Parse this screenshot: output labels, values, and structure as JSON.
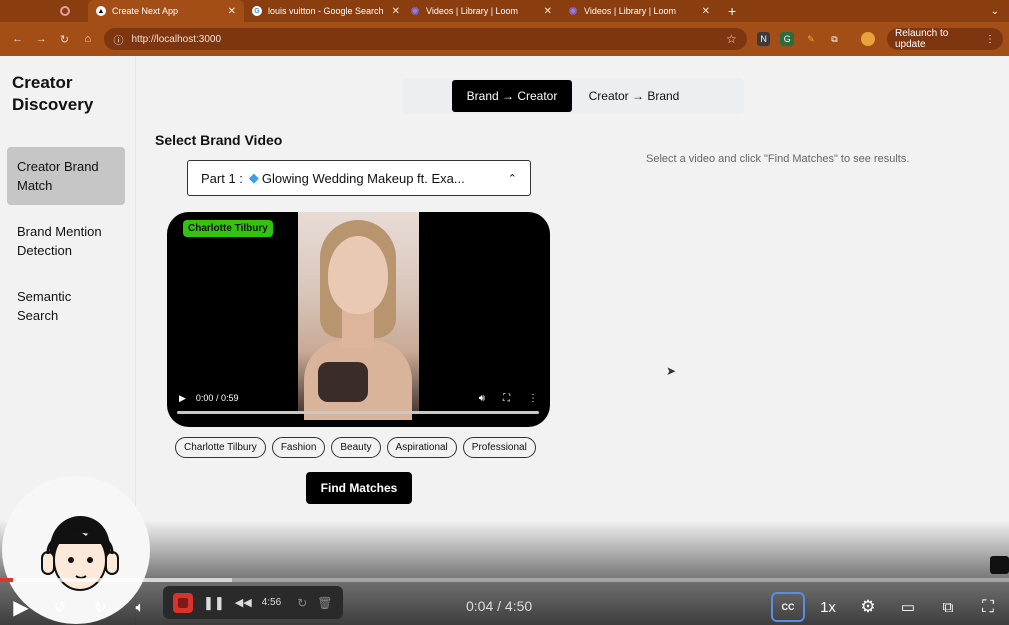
{
  "browser": {
    "tabs": [
      {
        "label": "",
        "icon": "record-icon"
      },
      {
        "label": "Create Next App",
        "icon": "nextjs-icon",
        "active": true
      },
      {
        "label": "louis vuitton - Google Search",
        "icon": "google-icon"
      },
      {
        "label": "Videos | Library | Loom",
        "icon": "loom-icon"
      },
      {
        "label": "Videos | Library | Loom",
        "icon": "loom-icon"
      }
    ],
    "url": "http://localhost:3000",
    "relaunch_label": "Relaunch to update"
  },
  "sidebar": {
    "title": "Creator Discovery",
    "items": [
      {
        "label": "Creator Brand Match",
        "active": true
      },
      {
        "label": "Brand Mention Detection",
        "active": false
      },
      {
        "label": "Semantic Search",
        "active": false
      }
    ]
  },
  "main": {
    "mode_toggle": {
      "options": [
        "Brand → Creator",
        "Creator → Brand"
      ],
      "selected": "Brand → Creator"
    },
    "section_title": "Select Brand Video",
    "select": {
      "prefix": "Part 1 :",
      "value": "Glowing Wedding Makeup ft. Exa..."
    },
    "video": {
      "brand_tag": "Charlotte Tilbury",
      "time": "0:00 / 0:59"
    },
    "tags": [
      "Charlotte Tilbury",
      "Fashion",
      "Beauty",
      "Aspirational",
      "Professional"
    ],
    "find_button": "Find Matches",
    "results_hint": "Select a video and click \"Find Matches\" to see results."
  },
  "loom": {
    "recording_time": "4:56",
    "playback_time": "0:04 / 4:50",
    "speed": "1x",
    "cc_label": "CC",
    "skip_back": "5",
    "skip_forward": "5",
    "progress_fraction": 0.013,
    "buffer_fraction": 0.23,
    "accent": "#e0342b"
  }
}
